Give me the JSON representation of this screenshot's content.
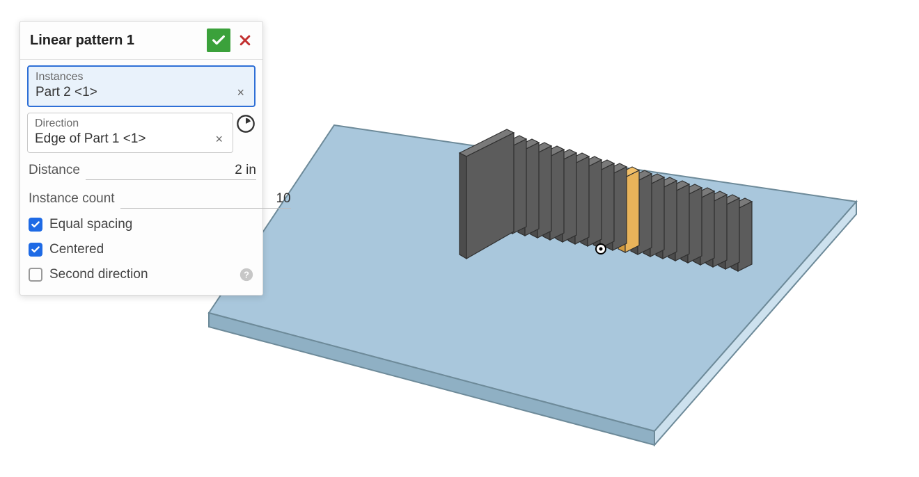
{
  "panel": {
    "title": "Linear pattern 1",
    "instances": {
      "label": "Instances",
      "value": "Part 2 <1>"
    },
    "direction": {
      "label": "Direction",
      "value": "Edge of Part 1 <1>"
    },
    "distance": {
      "label": "Distance",
      "value": "2 in"
    },
    "instanceCount": {
      "label": "Instance count",
      "value": "10"
    },
    "equalSpacing": {
      "label": "Equal spacing",
      "checked": true
    },
    "centered": {
      "label": "Centered",
      "checked": true
    },
    "secondDirection": {
      "label": "Second direction",
      "checked": false
    }
  },
  "viewport": {
    "description": "Isometric view of a rectangular light-blue plate with 20 dark-grey thin slab instances arranged in a linear pattern along one axis; one slab near center is highlighted amber with a direction point marker.",
    "plateColor": "#a9c7dc",
    "slabColor": "#5c5c5c",
    "highlightColor": "#e8b35a"
  }
}
